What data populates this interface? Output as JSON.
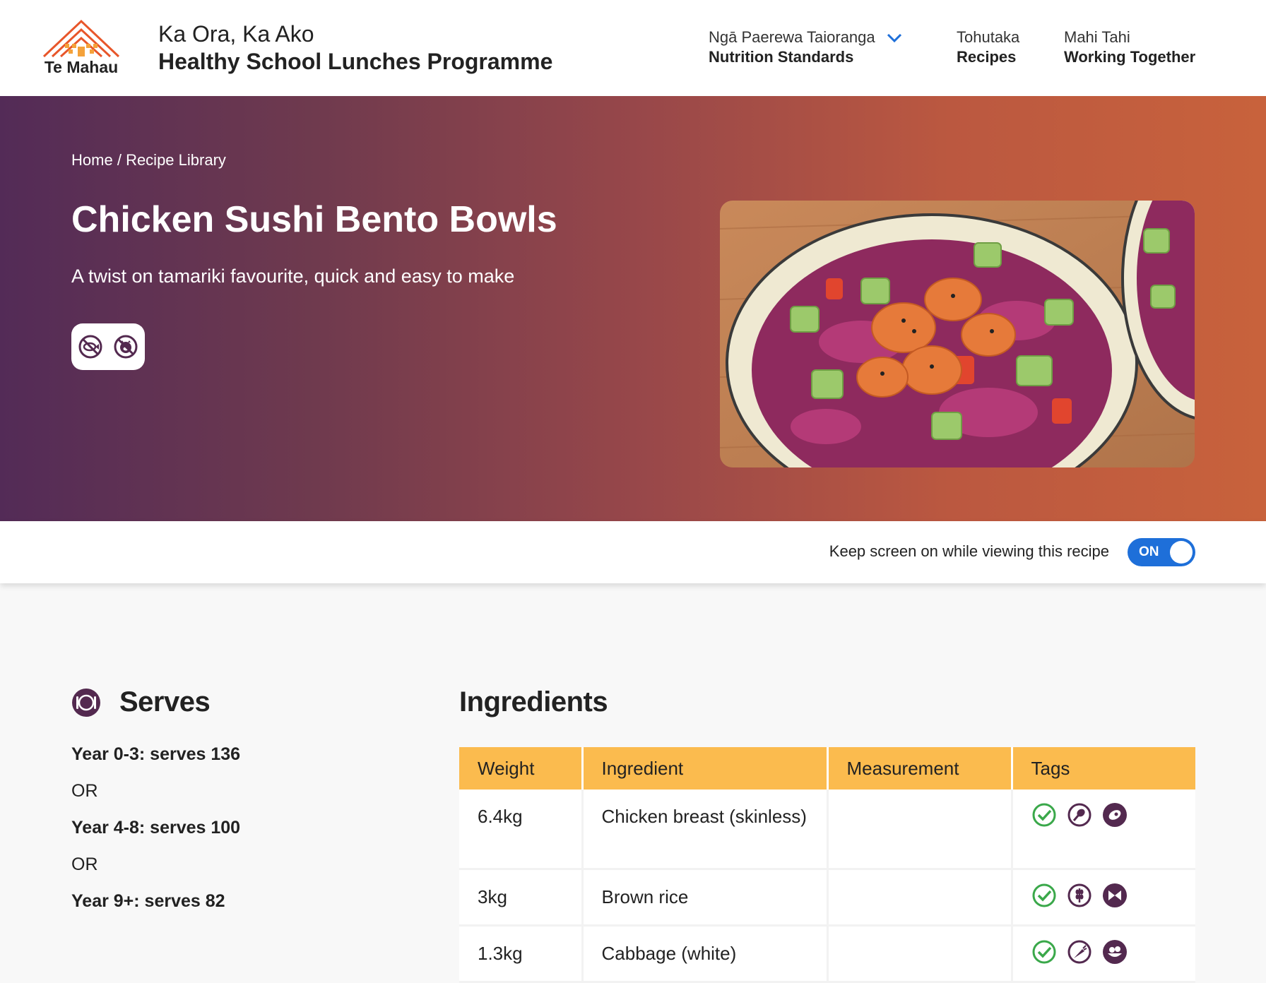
{
  "header": {
    "logo_text": "Te Mahau",
    "brand_sub": "Ka Ora, Ka Ako",
    "brand_main": "Healthy School Lunches Programme",
    "nav": [
      {
        "mi": "Ngā Paerewa Taioranga",
        "en": "Nutrition Standards",
        "has_dropdown": true
      },
      {
        "mi": "Tohutaka",
        "en": "Recipes"
      },
      {
        "mi": "Mahi Tahi",
        "en": "Working Together"
      }
    ]
  },
  "hero": {
    "breadcrumb_home": "Home",
    "breadcrumb_sep": "/",
    "breadcrumb_current": "Recipe Library",
    "title": "Chicken Sushi Bento Bowls",
    "subtitle": "A twist on tamariki favourite, quick and easy to make",
    "tag_icons": [
      "no-seafood-icon",
      "no-pork-icon"
    ]
  },
  "keep_screen": {
    "label": "Keep screen on while viewing this recipe",
    "toggle_label": "ON",
    "enabled": true
  },
  "serves": {
    "heading": "Serves",
    "items": [
      {
        "type": "year",
        "text": "Year 0-3: serves 136"
      },
      {
        "type": "or",
        "text": "OR"
      },
      {
        "type": "year",
        "text": "Year 4-8: serves 100"
      },
      {
        "type": "or",
        "text": "OR"
      },
      {
        "type": "year",
        "text": "Year 9+: serves 82"
      }
    ]
  },
  "ingredients": {
    "heading": "Ingredients",
    "columns": [
      "Weight",
      "Ingredient",
      "Measurement",
      "Tags"
    ],
    "rows": [
      {
        "weight": "6.4kg",
        "ingredient": "Chicken breast (skinless)",
        "measurement": "",
        "tags": [
          "check-icon",
          "drumstick-icon",
          "meat-icon"
        ]
      },
      {
        "weight": "3kg",
        "ingredient": "Brown rice",
        "measurement": "",
        "tags": [
          "check-icon",
          "grain-icon",
          "pasta-icon"
        ]
      },
      {
        "weight": "1.3kg",
        "ingredient": "Cabbage (white)",
        "measurement": "",
        "tags": [
          "check-icon",
          "carrot-icon",
          "vegetables-icon"
        ]
      }
    ]
  },
  "colors": {
    "hero_start": "#532b57",
    "hero_end": "#c8623c",
    "table_header": "#fbbb4e",
    "toggle": "#1e6fd9",
    "icon_purple": "#53294f",
    "check_green": "#3aa84a"
  }
}
